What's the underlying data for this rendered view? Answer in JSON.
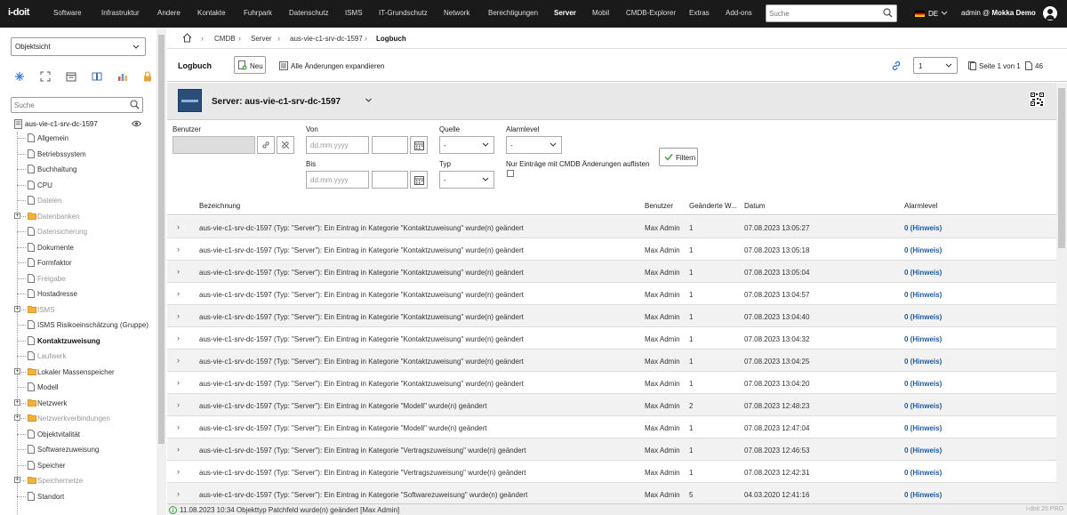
{
  "app": {
    "logo": "i-doit",
    "nav": [
      {
        "label": "Software",
        "active": false
      },
      {
        "label": "Infrastruktur",
        "active": false
      },
      {
        "label": "Andere",
        "active": false
      },
      {
        "label": "Kontakte",
        "active": false
      },
      {
        "label": "Fuhrpark",
        "active": false
      },
      {
        "label": "Datenschutz",
        "active": false
      },
      {
        "label": "ISMS",
        "active": false
      },
      {
        "label": "IT-Grundschutz",
        "active": false
      },
      {
        "label": "Network",
        "active": false
      },
      {
        "label": "Berechtigungen",
        "active": false
      },
      {
        "label": "Server",
        "active": true
      },
      {
        "label": "Mobil",
        "active": false
      },
      {
        "label": "CMDB-Explorer",
        "active": false
      },
      {
        "label": "Extras",
        "active": false
      },
      {
        "label": "Add-ons",
        "active": false
      }
    ],
    "search_placeholder": "Suche",
    "language": "DE",
    "user_prefix": "admin @ ",
    "user_tenant": "Mokka Demo"
  },
  "sidebar": {
    "view_select": "Objektsicht",
    "search_placeholder": "Suche",
    "tools": [
      "tree-icon",
      "expand-icon",
      "calendar-icon",
      "book-icon",
      "chart-icon",
      "lock-icon"
    ],
    "object": "aus-vie-c1-srv-dc-1597",
    "categories": [
      {
        "label": "Allgemein",
        "state": "normal",
        "folder": false,
        "expandable": false
      },
      {
        "label": "Betriebssystem",
        "state": "normal",
        "folder": false,
        "expandable": false
      },
      {
        "label": "Buchhaltung",
        "state": "normal",
        "folder": false,
        "expandable": false
      },
      {
        "label": "CPU",
        "state": "normal",
        "folder": false,
        "expandable": false
      },
      {
        "label": "Dateien",
        "state": "grey",
        "folder": false,
        "expandable": false
      },
      {
        "label": "Datenbanken",
        "state": "grey",
        "folder": true,
        "expandable": true
      },
      {
        "label": "Datensicherung",
        "state": "grey",
        "folder": false,
        "expandable": false
      },
      {
        "label": "Dokumente",
        "state": "normal",
        "folder": false,
        "expandable": false
      },
      {
        "label": "Formfaktor",
        "state": "normal",
        "folder": false,
        "expandable": false
      },
      {
        "label": "Freigabe",
        "state": "grey",
        "folder": false,
        "expandable": false
      },
      {
        "label": "Hostadresse",
        "state": "normal",
        "folder": false,
        "expandable": false
      },
      {
        "label": "ISMS",
        "state": "grey",
        "folder": true,
        "expandable": true
      },
      {
        "label": "ISMS Risikoeinschätzung (Gruppe)",
        "state": "normal",
        "folder": false,
        "expandable": false
      },
      {
        "label": "Kontaktzuweisung",
        "state": "bold",
        "folder": false,
        "expandable": false
      },
      {
        "label": "Laufwerk",
        "state": "grey",
        "folder": false,
        "expandable": false
      },
      {
        "label": "Lokaler Massenspeicher",
        "state": "normal",
        "folder": true,
        "expandable": true
      },
      {
        "label": "Modell",
        "state": "normal",
        "folder": false,
        "expandable": false
      },
      {
        "label": "Netzwerk",
        "state": "normal",
        "folder": true,
        "expandable": true
      },
      {
        "label": "Netzwerkverbindungen",
        "state": "grey",
        "folder": true,
        "expandable": true
      },
      {
        "label": "Objektvitalität",
        "state": "normal",
        "folder": false,
        "expandable": false
      },
      {
        "label": "Softwarezuweisung",
        "state": "normal",
        "folder": false,
        "expandable": false
      },
      {
        "label": "Speicher",
        "state": "normal",
        "folder": false,
        "expandable": false
      },
      {
        "label": "Speichernetze",
        "state": "grey",
        "folder": true,
        "expandable": true
      },
      {
        "label": "Standort",
        "state": "normal",
        "folder": false,
        "expandable": false
      }
    ]
  },
  "breadcrumb": [
    "CMDB",
    "Server",
    "aus-vie-c1-srv-dc-1597",
    "Logbuch"
  ],
  "toolbar": {
    "title": "Logbuch",
    "new_label": "Neu",
    "expand_label": "Alle Änderungen expandieren",
    "page_value": "1",
    "page_info": "Seite 1 von 1",
    "total": "46"
  },
  "object_header": {
    "title": "Server: aus-vie-c1-srv-dc-1597"
  },
  "filters": {
    "user_label": "Benutzer",
    "from_label": "Von",
    "to_label": "Bis",
    "date_placeholder": "dd.mm.yyyy",
    "source_label": "Quelle",
    "source_value": "-",
    "type_label": "Typ",
    "type_value": "-",
    "alarm_label": "Alarmlevel",
    "alarm_value": "-",
    "cmdb_only_label": "Nur Einträge mit CMDB Änderungen auflisten",
    "filter_button": "Filtern"
  },
  "table": {
    "headers": [
      "Bezeichnung",
      "Benutzer",
      "Geänderte W...",
      "Datum",
      "Alarmlevel"
    ],
    "rows": [
      {
        "desc": "aus-vie-c1-srv-dc-1597 (Typ: \"Server\"): Ein Eintrag in Kategorie \"Kontaktzuweisung\" wurde(n) geändert",
        "user": "Max Admin",
        "changed": "1",
        "date": "07.08.2023 13:05:27",
        "alarm": "0 (Hinweis)"
      },
      {
        "desc": "aus-vie-c1-srv-dc-1597 (Typ: \"Server\"): Ein Eintrag in Kategorie \"Kontaktzuweisung\" wurde(n) geändert",
        "user": "Max Admin",
        "changed": "1",
        "date": "07.08.2023 13:05:18",
        "alarm": "0 (Hinweis)"
      },
      {
        "desc": "aus-vie-c1-srv-dc-1597 (Typ: \"Server\"): Ein Eintrag in Kategorie \"Kontaktzuweisung\" wurde(n) geändert",
        "user": "Max Admin",
        "changed": "1",
        "date": "07.08.2023 13:05:04",
        "alarm": "0 (Hinweis)"
      },
      {
        "desc": "aus-vie-c1-srv-dc-1597 (Typ: \"Server\"): Ein Eintrag in Kategorie \"Kontaktzuweisung\" wurde(n) geändert",
        "user": "Max Admin",
        "changed": "1",
        "date": "07.08.2023 13:04:57",
        "alarm": "0 (Hinweis)"
      },
      {
        "desc": "aus-vie-c1-srv-dc-1597 (Typ: \"Server\"): Ein Eintrag in Kategorie \"Kontaktzuweisung\" wurde(n) geändert",
        "user": "Max Admin",
        "changed": "1",
        "date": "07.08.2023 13:04:40",
        "alarm": "0 (Hinweis)"
      },
      {
        "desc": "aus-vie-c1-srv-dc-1597 (Typ: \"Server\"): Ein Eintrag in Kategorie \"Kontaktzuweisung\" wurde(n) geändert",
        "user": "Max Admin",
        "changed": "1",
        "date": "07.08.2023 13:04:32",
        "alarm": "0 (Hinweis)"
      },
      {
        "desc": "aus-vie-c1-srv-dc-1597 (Typ: \"Server\"): Ein Eintrag in Kategorie \"Kontaktzuweisung\" wurde(n) geändert",
        "user": "Max Admin",
        "changed": "1",
        "date": "07.08.2023 13:04:25",
        "alarm": "0 (Hinweis)"
      },
      {
        "desc": "aus-vie-c1-srv-dc-1597 (Typ: \"Server\"): Ein Eintrag in Kategorie \"Kontaktzuweisung\" wurde(n) geändert",
        "user": "Max Admin",
        "changed": "1",
        "date": "07.08.2023 13:04:20",
        "alarm": "0 (Hinweis)"
      },
      {
        "desc": "aus-vie-c1-srv-dc-1597 (Typ: \"Server\"): Ein Eintrag in Kategorie \"Modell\" wurde(n) geändert",
        "user": "Max Admin",
        "changed": "2",
        "date": "07.08.2023 12:48:23",
        "alarm": "0 (Hinweis)"
      },
      {
        "desc": "aus-vie-c1-srv-dc-1597 (Typ: \"Server\"): Ein Eintrag in Kategorie \"Modell\" wurde(n) geändert",
        "user": "Max Admin",
        "changed": "1",
        "date": "07.08.2023 12:47:04",
        "alarm": "0 (Hinweis)"
      },
      {
        "desc": "aus-vie-c1-srv-dc-1597 (Typ: \"Server\"): Ein Eintrag in Kategorie \"Vertragszuweisung\" wurde(n) geändert",
        "user": "Max Admin",
        "changed": "1",
        "date": "07.08.2023 12:46:53",
        "alarm": "0 (Hinweis)"
      },
      {
        "desc": "aus-vie-c1-srv-dc-1597 (Typ: \"Server\"): Ein Eintrag in Kategorie \"Vertragszuweisung\" wurde(n) geändert",
        "user": "Max Admin",
        "changed": "1",
        "date": "07.08.2023 12:42:31",
        "alarm": "0 (Hinweis)"
      },
      {
        "desc": "aus-vie-c1-srv-dc-1597 (Typ: \"Server\"): Ein Eintrag in Kategorie \"Softwarezuweisung\" wurde(n) geändert",
        "user": "Max Admin",
        "changed": "5",
        "date": "04.03.2020 12:41:16",
        "alarm": "0 (Hinweis)"
      }
    ]
  },
  "status": {
    "message": "11.08.2023 10:34 Objekttyp Patchfeld wurde(n) geändert [Max Admin]",
    "version": "i-doit 25 PRO"
  },
  "colors": {
    "nav_bg": "#1a1a1a",
    "alarm_link": "#1d5a9c",
    "folder": "#f2b33d",
    "zebra": "#f2f2f2"
  }
}
